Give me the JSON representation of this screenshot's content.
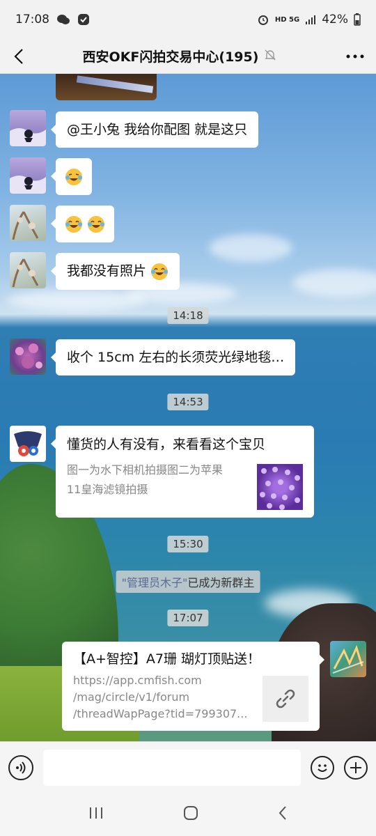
{
  "status_bar": {
    "time": "17:08",
    "battery": "42%",
    "network": "HD 5G"
  },
  "nav": {
    "title": "西安OKF闪拍交易中心(195)"
  },
  "messages": {
    "m1": "@王小兔  我给你配图  就是这只",
    "m4": "我都没有照片",
    "m5": "收个 15cm 左右的长须荧光绿地毯…",
    "m6_title": "懂货的人有没有，来看看这个宝贝",
    "m6_desc_1": "图一为水下相机拍摄图二为苹果",
    "m6_desc_2": "11皇海滤镜拍摄",
    "link_title": "【A+智控】A7珊 瑚灯顶贴送！",
    "link_url_1": "https://app.cmfish.com",
    "link_url_2": "/mag/circle/v1/forum",
    "link_url_3": "/threadWapPage?tid=799307..."
  },
  "timestamps": {
    "t1": "14:18",
    "t2": "14:53",
    "t3": "15:30",
    "t4": "17:07"
  },
  "system": {
    "name": "\"管理员木子\"",
    "text": "已成为新群主"
  },
  "input": {
    "placeholder": ""
  }
}
